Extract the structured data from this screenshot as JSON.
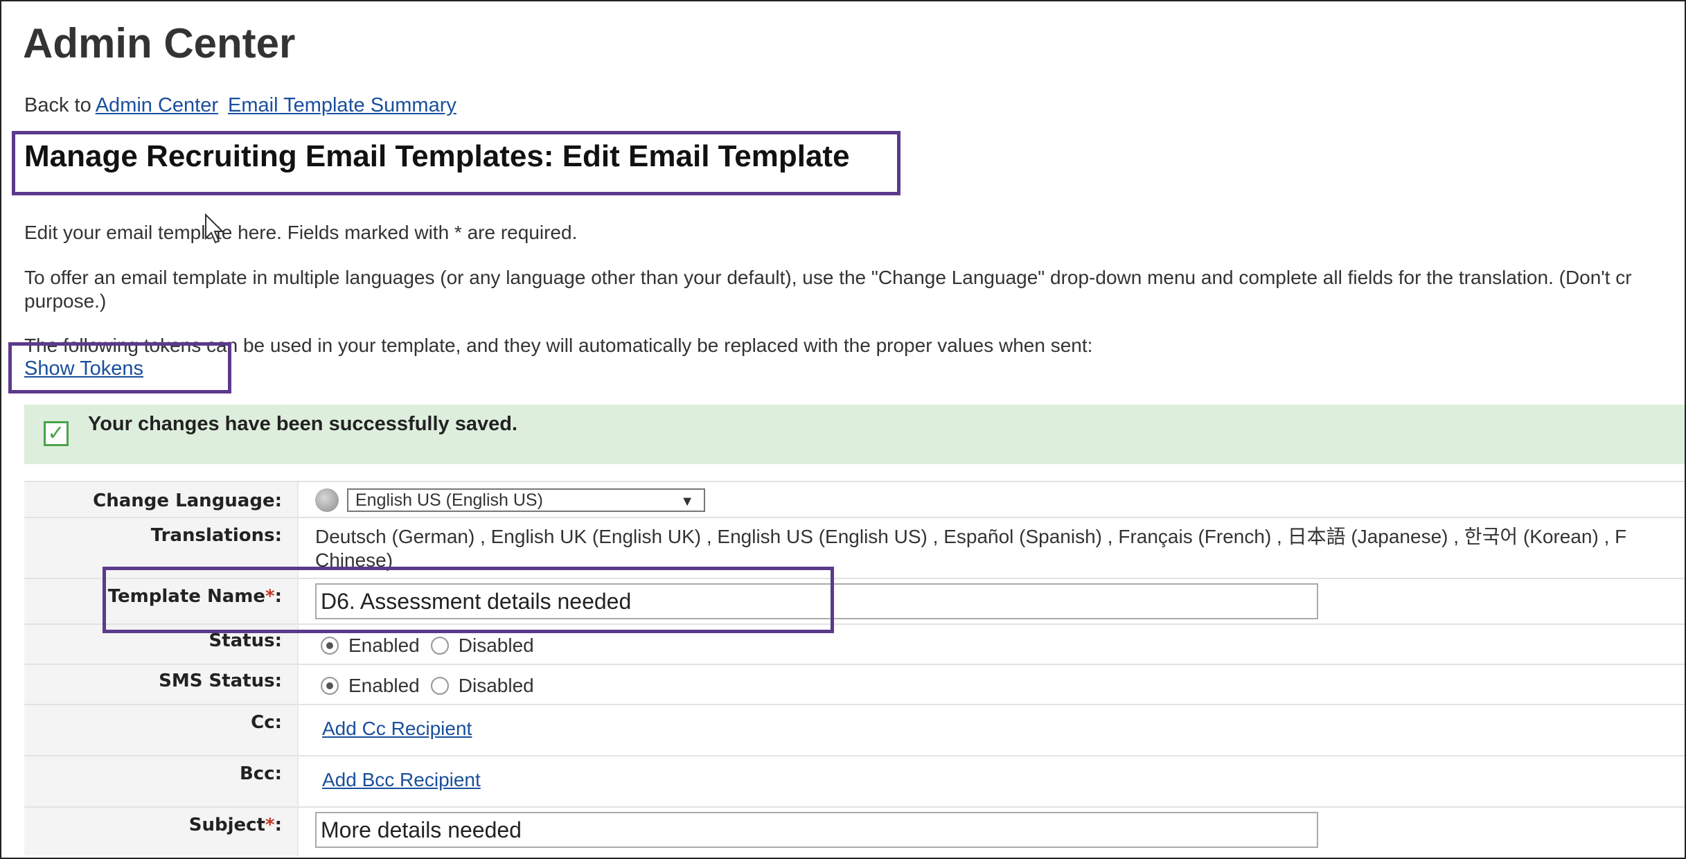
{
  "app_title": "Admin Center",
  "nav": {
    "back_to": "Back to",
    "admin_center_link": "Admin Center",
    "summary_link": "Email Template Summary"
  },
  "page_title": "Manage Recruiting Email Templates: Edit Email Template",
  "intro": {
    "line1": "Edit your email template here. Fields marked with * are required.",
    "line2": "To offer an email template in multiple languages (or any language other than your default), use the \"Change Language\" drop-down menu and complete all fields for the translation. (Don't cr",
    "line2_cont": "purpose.)",
    "line3": "The following tokens can be used in your template, and they will automatically be replaced with the proper values when sent:",
    "show_tokens": "Show Tokens"
  },
  "success_message": "Your changes have been successfully saved.",
  "form": {
    "change_language": {
      "label": "Change Language:",
      "value": "English US (English US)"
    },
    "translations": {
      "label": "Translations:",
      "value": "Deutsch (German) , English UK (English UK) , English US (English US) , Español (Spanish) , Français (French) , 日本語 (Japanese) , 한국어 (Korean) , F",
      "value_cont": "Chinese)"
    },
    "template_name": {
      "label": "Template Name",
      "required_mark": "*",
      "colon": ":",
      "value": "D6. Assessment details needed"
    },
    "status": {
      "label": "Status:",
      "enabled": "Enabled",
      "disabled": "Disabled",
      "selected": "enabled"
    },
    "sms_status": {
      "label": "SMS Status:",
      "enabled": "Enabled",
      "disabled": "Disabled",
      "selected": "enabled"
    },
    "cc": {
      "label": "Cc:",
      "link": "Add Cc Recipient"
    },
    "bcc": {
      "label": "Bcc:",
      "link": "Add Bcc Recipient"
    },
    "subject": {
      "label": "Subject",
      "required_mark": "*",
      "colon": ":",
      "value": "More details needed"
    }
  },
  "colors": {
    "highlight": "#5b3a8c",
    "link": "#1a4f9c",
    "success_bg": "#deeedd",
    "required": "#c0392b"
  }
}
